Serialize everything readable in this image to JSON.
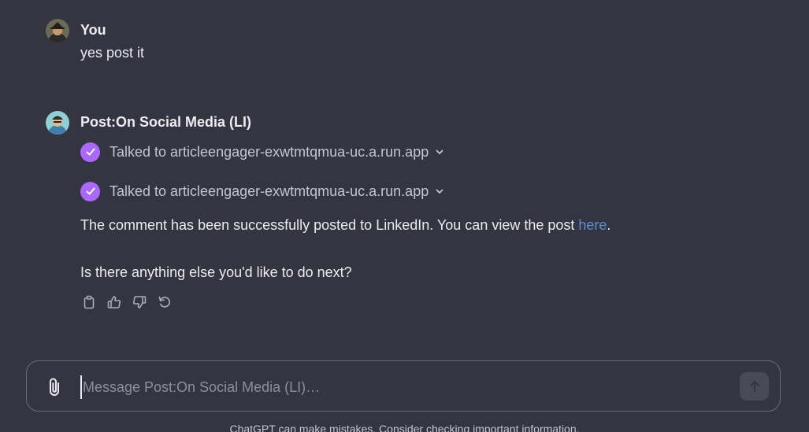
{
  "conversation": {
    "user_message": {
      "author": "You",
      "text": "yes post it",
      "avatar_icon": "user-avatar"
    },
    "assistant_message": {
      "author": "Post:On Social Media (LI)",
      "avatar_icon": "gpt-avatar",
      "tool_calls": [
        {
          "label": "Talked to articleengager-exwtmtqmua-uc.a.run.app",
          "icon": "check-icon"
        },
        {
          "label": "Talked to articleengager-exwtmtqmua-uc.a.run.app",
          "icon": "check-icon"
        }
      ],
      "response_text": "The comment has been successfully posted to LinkedIn. You can view the post ",
      "link_text": "here",
      "response_suffix": ".",
      "followup_text": "Is there anything else you'd like to do next?",
      "actions": [
        "copy-icon",
        "thumbs-up-icon",
        "thumbs-down-icon",
        "regenerate-icon"
      ]
    }
  },
  "composer": {
    "placeholder": "Message Post:On Social Media (LI)…",
    "attach_icon": "paperclip-icon",
    "send_icon": "arrow-up-icon"
  },
  "footer": {
    "disclaimer": "ChatGPT can make mistakes. Consider checking important information."
  },
  "colors": {
    "background": "#343541",
    "accent_check": "#ab68ff",
    "link": "#5b8fd6"
  }
}
